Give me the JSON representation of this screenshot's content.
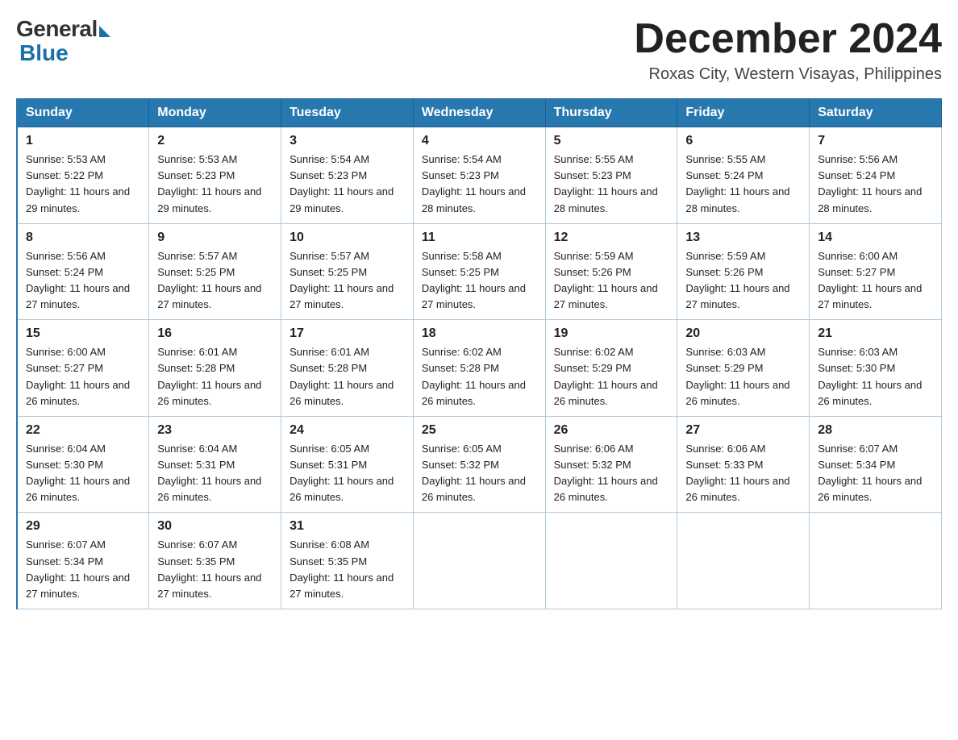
{
  "logo": {
    "general": "General",
    "blue": "Blue"
  },
  "header": {
    "month_year": "December 2024",
    "location": "Roxas City, Western Visayas, Philippines"
  },
  "days_of_week": [
    "Sunday",
    "Monday",
    "Tuesday",
    "Wednesday",
    "Thursday",
    "Friday",
    "Saturday"
  ],
  "weeks": [
    [
      {
        "day": "1",
        "sunrise": "5:53 AM",
        "sunset": "5:22 PM",
        "daylight": "11 hours and 29 minutes."
      },
      {
        "day": "2",
        "sunrise": "5:53 AM",
        "sunset": "5:23 PM",
        "daylight": "11 hours and 29 minutes."
      },
      {
        "day": "3",
        "sunrise": "5:54 AM",
        "sunset": "5:23 PM",
        "daylight": "11 hours and 29 minutes."
      },
      {
        "day": "4",
        "sunrise": "5:54 AM",
        "sunset": "5:23 PM",
        "daylight": "11 hours and 28 minutes."
      },
      {
        "day": "5",
        "sunrise": "5:55 AM",
        "sunset": "5:23 PM",
        "daylight": "11 hours and 28 minutes."
      },
      {
        "day": "6",
        "sunrise": "5:55 AM",
        "sunset": "5:24 PM",
        "daylight": "11 hours and 28 minutes."
      },
      {
        "day": "7",
        "sunrise": "5:56 AM",
        "sunset": "5:24 PM",
        "daylight": "11 hours and 28 minutes."
      }
    ],
    [
      {
        "day": "8",
        "sunrise": "5:56 AM",
        "sunset": "5:24 PM",
        "daylight": "11 hours and 27 minutes."
      },
      {
        "day": "9",
        "sunrise": "5:57 AM",
        "sunset": "5:25 PM",
        "daylight": "11 hours and 27 minutes."
      },
      {
        "day": "10",
        "sunrise": "5:57 AM",
        "sunset": "5:25 PM",
        "daylight": "11 hours and 27 minutes."
      },
      {
        "day": "11",
        "sunrise": "5:58 AM",
        "sunset": "5:25 PM",
        "daylight": "11 hours and 27 minutes."
      },
      {
        "day": "12",
        "sunrise": "5:59 AM",
        "sunset": "5:26 PM",
        "daylight": "11 hours and 27 minutes."
      },
      {
        "day": "13",
        "sunrise": "5:59 AM",
        "sunset": "5:26 PM",
        "daylight": "11 hours and 27 minutes."
      },
      {
        "day": "14",
        "sunrise": "6:00 AM",
        "sunset": "5:27 PM",
        "daylight": "11 hours and 27 minutes."
      }
    ],
    [
      {
        "day": "15",
        "sunrise": "6:00 AM",
        "sunset": "5:27 PM",
        "daylight": "11 hours and 26 minutes."
      },
      {
        "day": "16",
        "sunrise": "6:01 AM",
        "sunset": "5:28 PM",
        "daylight": "11 hours and 26 minutes."
      },
      {
        "day": "17",
        "sunrise": "6:01 AM",
        "sunset": "5:28 PM",
        "daylight": "11 hours and 26 minutes."
      },
      {
        "day": "18",
        "sunrise": "6:02 AM",
        "sunset": "5:28 PM",
        "daylight": "11 hours and 26 minutes."
      },
      {
        "day": "19",
        "sunrise": "6:02 AM",
        "sunset": "5:29 PM",
        "daylight": "11 hours and 26 minutes."
      },
      {
        "day": "20",
        "sunrise": "6:03 AM",
        "sunset": "5:29 PM",
        "daylight": "11 hours and 26 minutes."
      },
      {
        "day": "21",
        "sunrise": "6:03 AM",
        "sunset": "5:30 PM",
        "daylight": "11 hours and 26 minutes."
      }
    ],
    [
      {
        "day": "22",
        "sunrise": "6:04 AM",
        "sunset": "5:30 PM",
        "daylight": "11 hours and 26 minutes."
      },
      {
        "day": "23",
        "sunrise": "6:04 AM",
        "sunset": "5:31 PM",
        "daylight": "11 hours and 26 minutes."
      },
      {
        "day": "24",
        "sunrise": "6:05 AM",
        "sunset": "5:31 PM",
        "daylight": "11 hours and 26 minutes."
      },
      {
        "day": "25",
        "sunrise": "6:05 AM",
        "sunset": "5:32 PM",
        "daylight": "11 hours and 26 minutes."
      },
      {
        "day": "26",
        "sunrise": "6:06 AM",
        "sunset": "5:32 PM",
        "daylight": "11 hours and 26 minutes."
      },
      {
        "day": "27",
        "sunrise": "6:06 AM",
        "sunset": "5:33 PM",
        "daylight": "11 hours and 26 minutes."
      },
      {
        "day": "28",
        "sunrise": "6:07 AM",
        "sunset": "5:34 PM",
        "daylight": "11 hours and 26 minutes."
      }
    ],
    [
      {
        "day": "29",
        "sunrise": "6:07 AM",
        "sunset": "5:34 PM",
        "daylight": "11 hours and 27 minutes."
      },
      {
        "day": "30",
        "sunrise": "6:07 AM",
        "sunset": "5:35 PM",
        "daylight": "11 hours and 27 minutes."
      },
      {
        "day": "31",
        "sunrise": "6:08 AM",
        "sunset": "5:35 PM",
        "daylight": "11 hours and 27 minutes."
      },
      null,
      null,
      null,
      null
    ]
  ],
  "labels": {
    "sunrise": "Sunrise:",
    "sunset": "Sunset:",
    "daylight": "Daylight:"
  }
}
